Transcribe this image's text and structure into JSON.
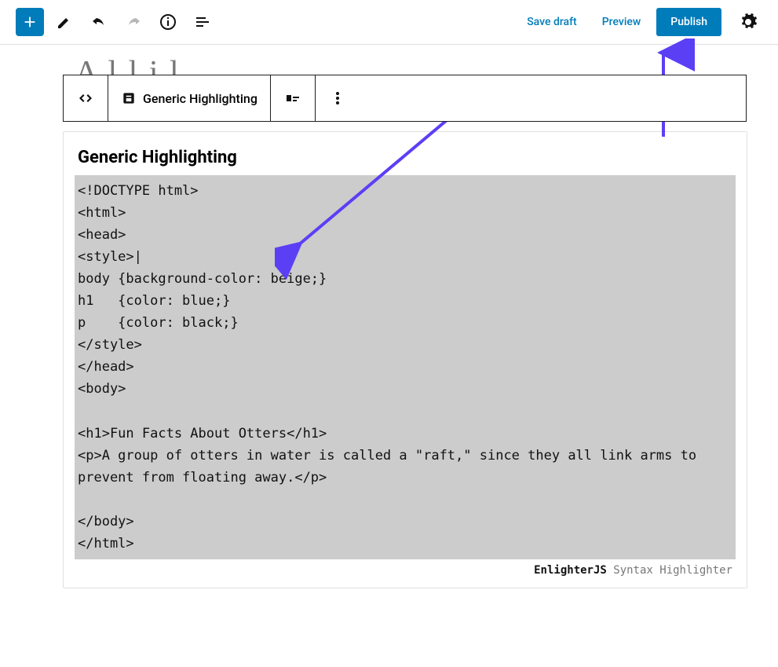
{
  "topbar": {
    "save_draft": "Save draft",
    "preview": "Preview",
    "publish": "Publish"
  },
  "partial_title": "A   l   l      i        l",
  "block_toolbar": {
    "label": "Generic Highlighting"
  },
  "code_block": {
    "title": "Generic Highlighting",
    "content": "<!DOCTYPE html>\n<html>\n<head>\n<style>|\nbody {background-color: beige;}\nh1   {color: blue;}\np    {color: black;}\n</style>\n</head>\n<body>\n\n<h1>Fun Facts About Otters</h1>\n<p>A group of otters in water is called a \"raft,\" since they all link arms to prevent from floating away.</p>\n\n</body>\n</html>\n",
    "footer_brand": "EnlighterJS",
    "footer_text": " Syntax Highlighter"
  },
  "colors": {
    "accent": "#007cba",
    "arrow": "#5b3ff5"
  }
}
